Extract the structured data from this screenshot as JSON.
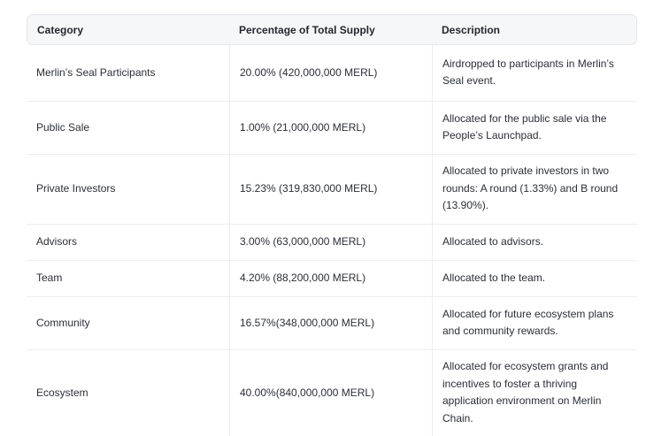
{
  "table": {
    "headers": [
      "Category",
      "Percentage of Total Supply",
      "Description"
    ],
    "rows": [
      {
        "category": "Merlin’s Seal Participants",
        "percentage": "20.00% (420,000,000 MERL)",
        "description": "Airdropped to participants in Merlin’s Seal event."
      },
      {
        "category": "Public Sale",
        "percentage": "1.00% (21,000,000 MERL)",
        "description": "Allocated for the public sale via the People’s Launchpad."
      },
      {
        "category": "Private Investors",
        "percentage": "15.23% (319,830,000 MERL)",
        "description": "Allocated to private investors in two rounds: A round (1.33%) and B round (13.90%)."
      },
      {
        "category": "Advisors",
        "percentage": "3.00% (63,000,000 MERL)",
        "description": "Allocated to advisors."
      },
      {
        "category": "Team",
        "percentage": "4.20% (88,200,000 MERL)",
        "description": "Allocated to the team."
      },
      {
        "category": "Community",
        "percentage": "16.57%(348,000,000 MERL)",
        "description": "Allocated for future ecosystem plans and community rewards."
      },
      {
        "category": "Ecosystem",
        "percentage": "40.00%(840,000,000 MERL)",
        "description": "Allocated for ecosystem grants and incentives to foster a thriving application environment on Merlin Chain."
      }
    ]
  }
}
